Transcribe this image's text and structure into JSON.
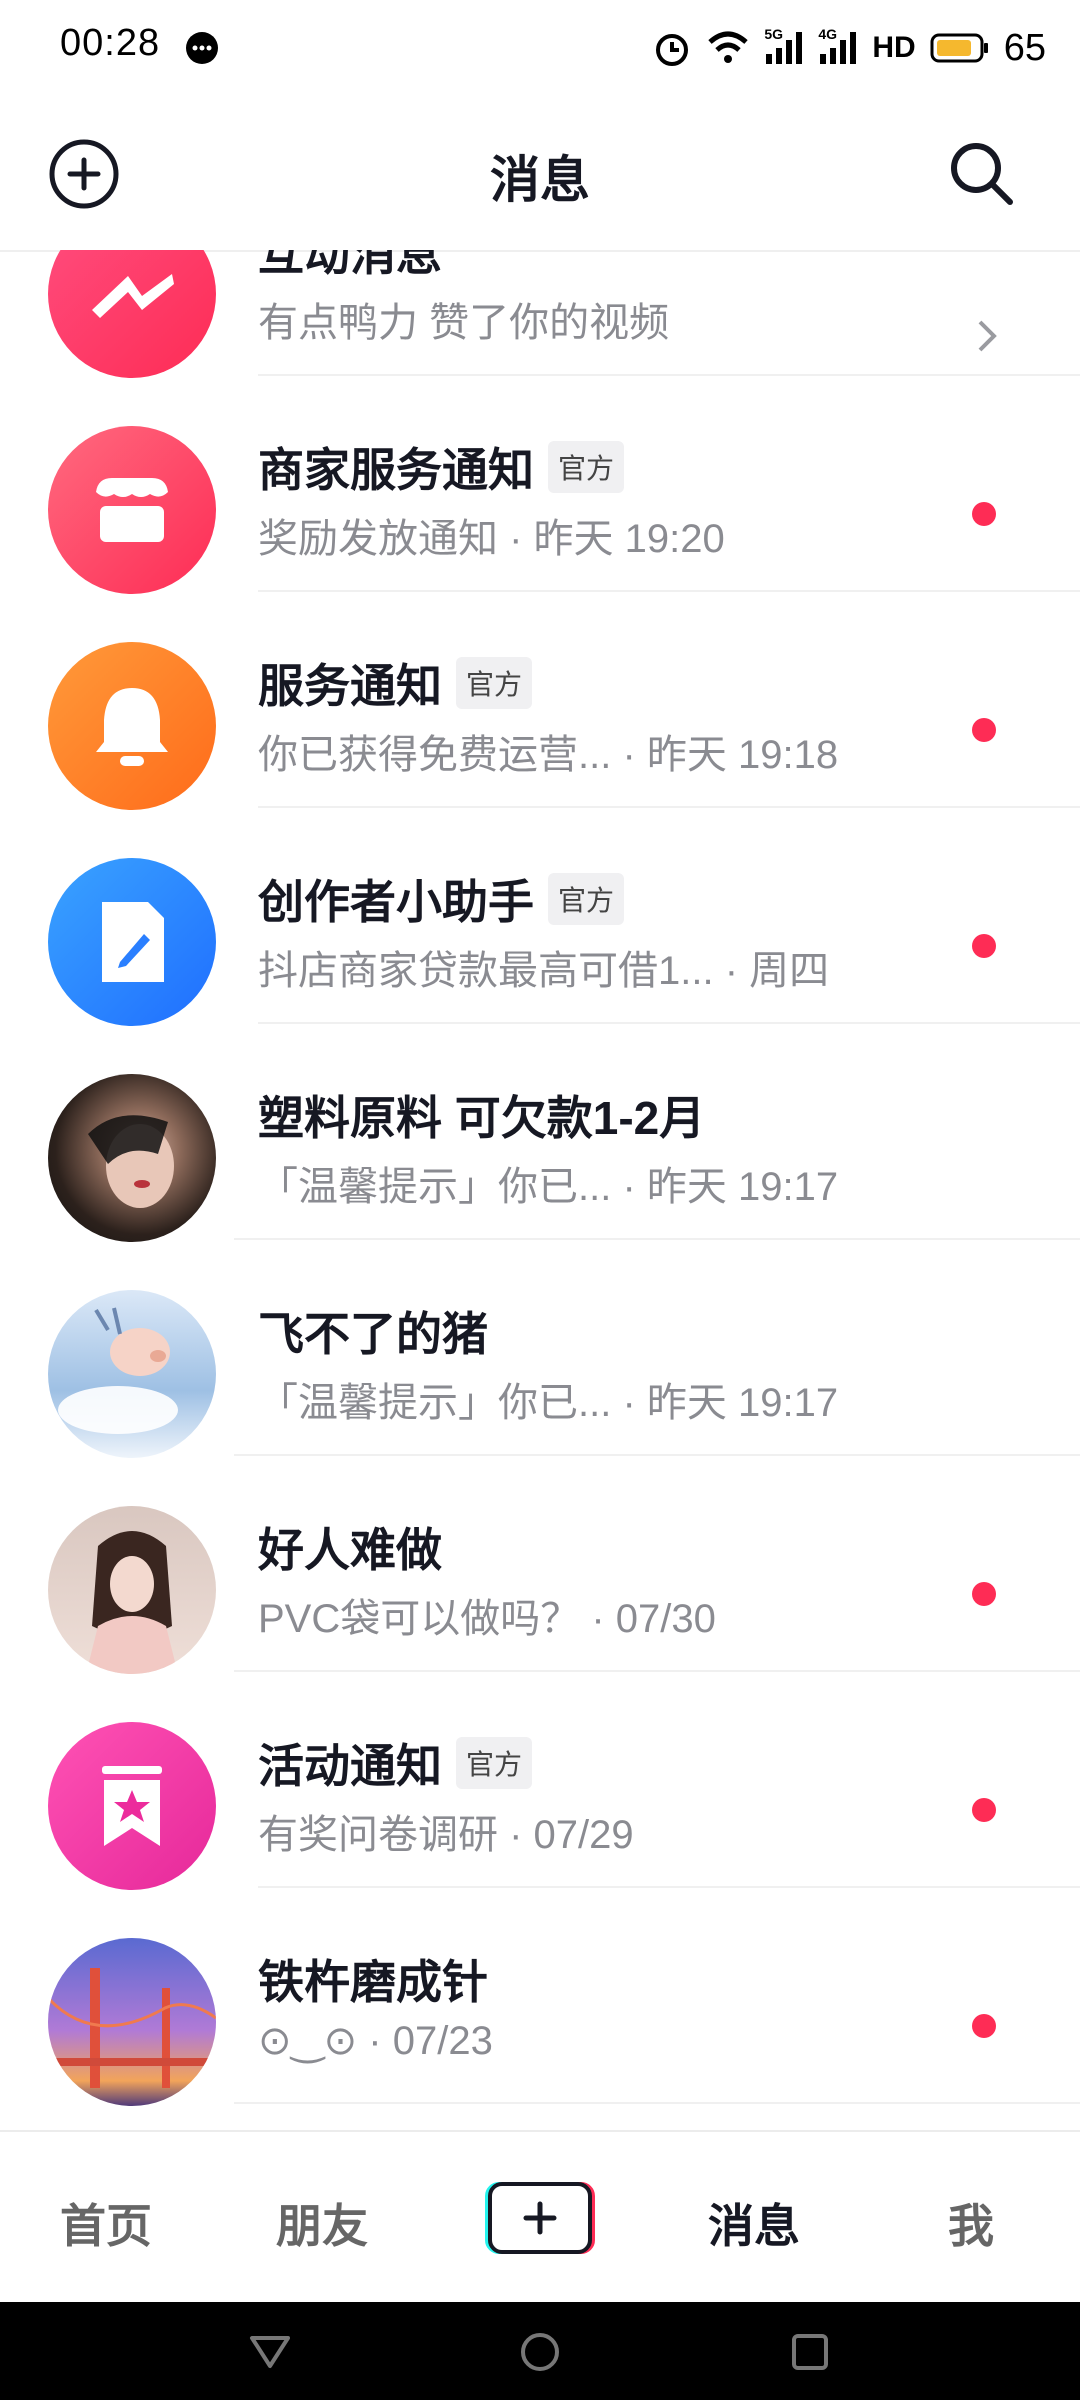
{
  "status_bar": {
    "time": "00:28",
    "network_5g": "5G",
    "network_4g": "4G",
    "hd": "HD",
    "battery": "65"
  },
  "header": {
    "title": "消息"
  },
  "messages": [
    {
      "title": "互动消息",
      "subtitle": "有点鸭力 赞了你的视频",
      "unread": false,
      "icon": "lightning-icon",
      "color": "#fe2c55"
    },
    {
      "title": "商家服务通知",
      "badge": "官方",
      "subtitle": "奖励发放通知 · 昨天 19:20",
      "unread": true,
      "icon": "store-icon",
      "color": "#fe4b6a"
    },
    {
      "title": "服务通知",
      "badge": "官方",
      "subtitle": "你已获得免费运营... · 昨天 19:18",
      "unread": true,
      "icon": "bell-icon",
      "color": "#ff7a2a"
    },
    {
      "title": "创作者小助手",
      "badge": "官方",
      "subtitle": "抖店商家贷款最高可借1...  · 周四",
      "unread": true,
      "icon": "edit-doc-icon",
      "color": "#2a8cff"
    },
    {
      "title": "塑料原料 可欠款1-2月",
      "subtitle": "「温馨提示」你已... · 昨天 19:17",
      "unread": false,
      "icon": "user-avatar",
      "color": "#3b2a22"
    },
    {
      "title": "飞不了的猪",
      "subtitle": "「温馨提示」你已... · 昨天 19:17",
      "unread": false,
      "icon": "user-avatar",
      "color": "#b7d2ee"
    },
    {
      "title": "好人难做",
      "subtitle": "PVC袋可以做吗？ · 07/30",
      "unread": true,
      "icon": "user-avatar",
      "color": "#e8c3b8"
    },
    {
      "title": "活动通知",
      "badge": "官方",
      "subtitle": "有奖问卷调研 · 07/29",
      "unread": true,
      "icon": "bookmark-star-icon",
      "color": "#ee2d9a"
    },
    {
      "title": "铁杵磨成针",
      "subtitle": "⊙‿⊙ · 07/23",
      "unread": true,
      "icon": "user-avatar",
      "color": "#8b7bb8"
    }
  ],
  "tabbar": {
    "home": "首页",
    "friends": "朋友",
    "messages": "消息",
    "me": "我"
  },
  "colors": {
    "accent": "#fe2c55",
    "text": "#161823",
    "secondary": "#8a8b91"
  }
}
